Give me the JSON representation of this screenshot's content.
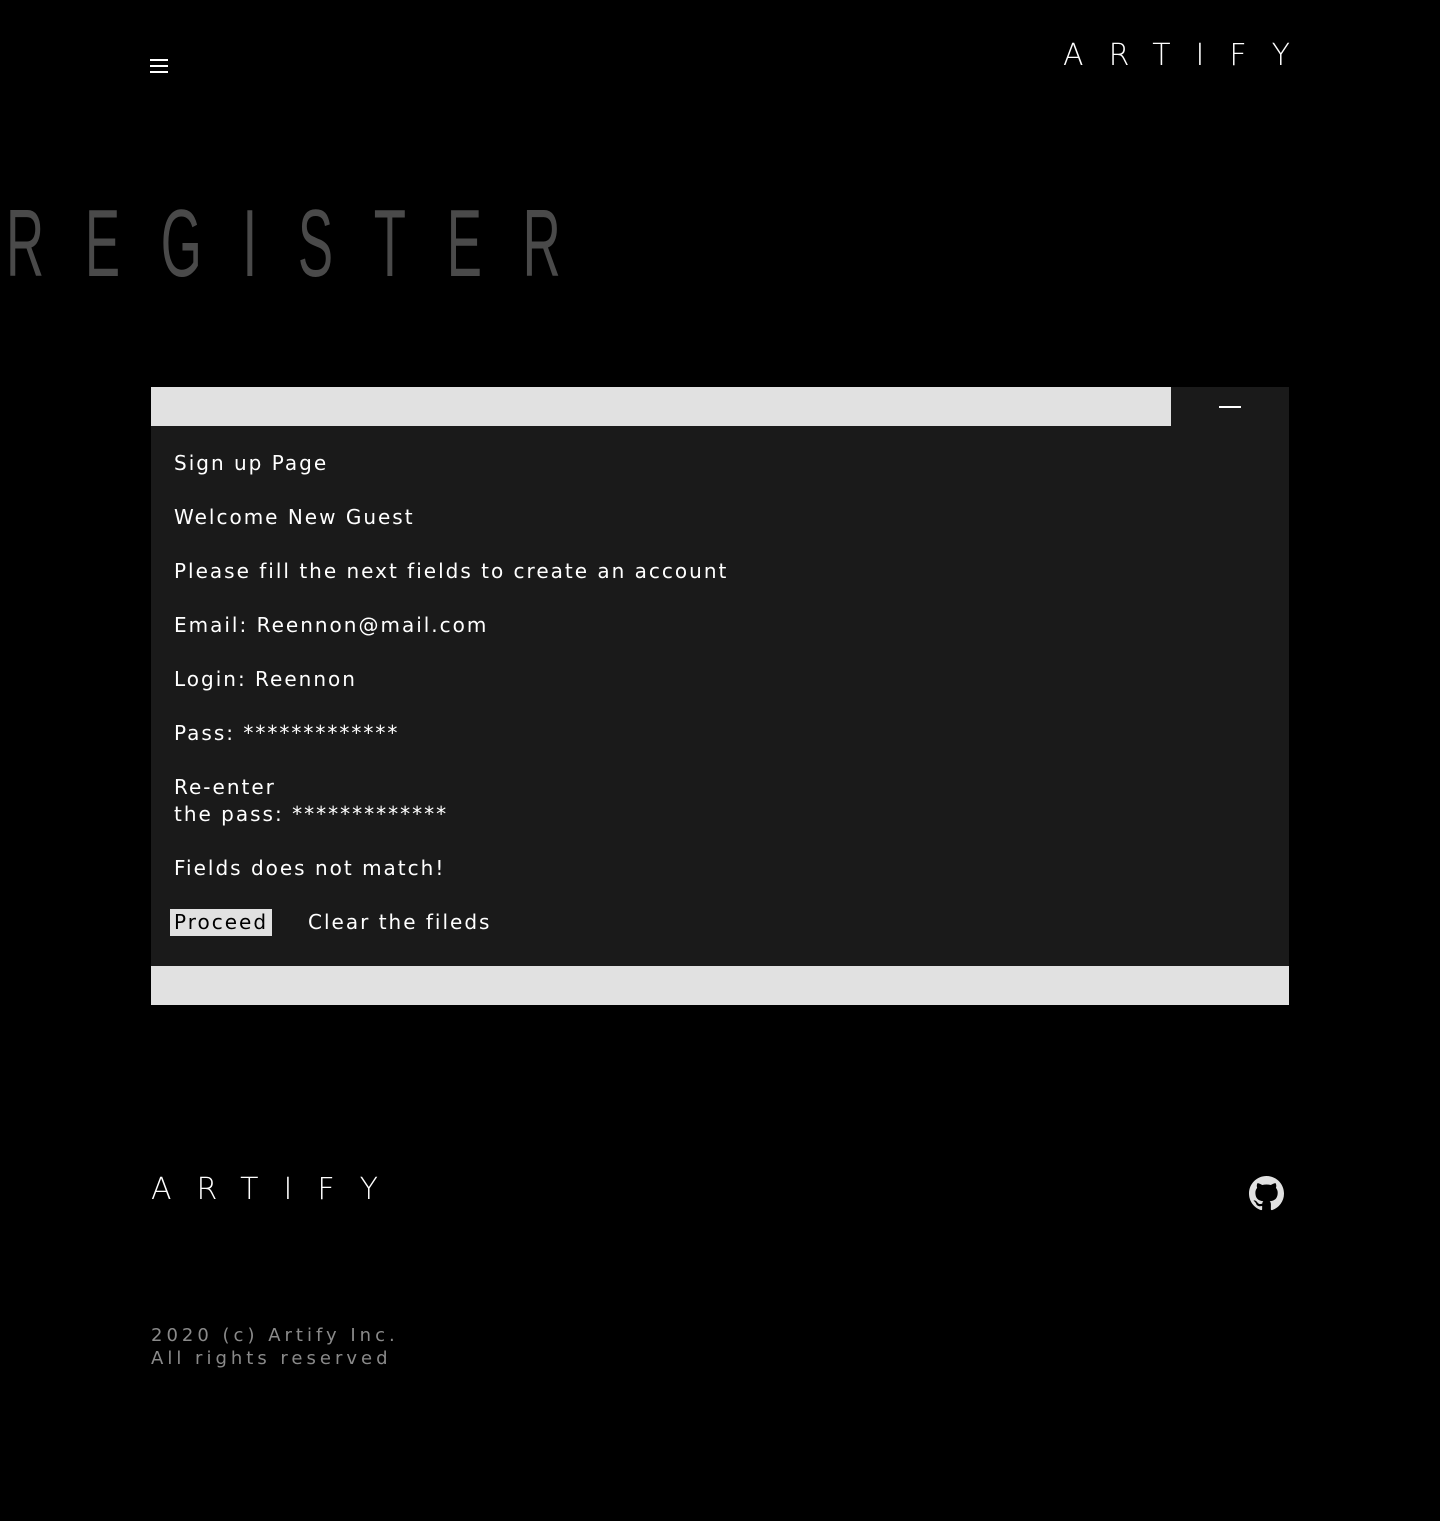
{
  "header": {
    "brand": "ARTIFY",
    "menu_icon": "hamburger-menu-icon"
  },
  "hero": {
    "title": "REGISTER"
  },
  "panel": {
    "collapse_icon": "minus-icon",
    "lines": {
      "title": "Sign up Page",
      "welcome": "Welcome New Guest",
      "instruction": "Please fill the next fields to create an account",
      "email": "Email: Reennon@mail.com",
      "login": "Login: Reennon",
      "pass": "Pass: *************",
      "reenter_line1": "Re-enter",
      "reenter_line2": "the pass: *************",
      "error": "Fields does not match!"
    },
    "actions": {
      "proceed_label": "Proceed",
      "clear_label": "Clear the fileds"
    }
  },
  "footer": {
    "brand": "ARTIFY",
    "github_icon": "github-icon",
    "copyright_line1": "2020 (c) Artify Inc.",
    "copyright_line2": "All rights reserved"
  },
  "colors": {
    "background": "#000000",
    "panel": "#1a1a1a",
    "bar": "#e1e1e1",
    "hero_text": "#4a4a4a",
    "muted_text": "#8a8a8a"
  }
}
